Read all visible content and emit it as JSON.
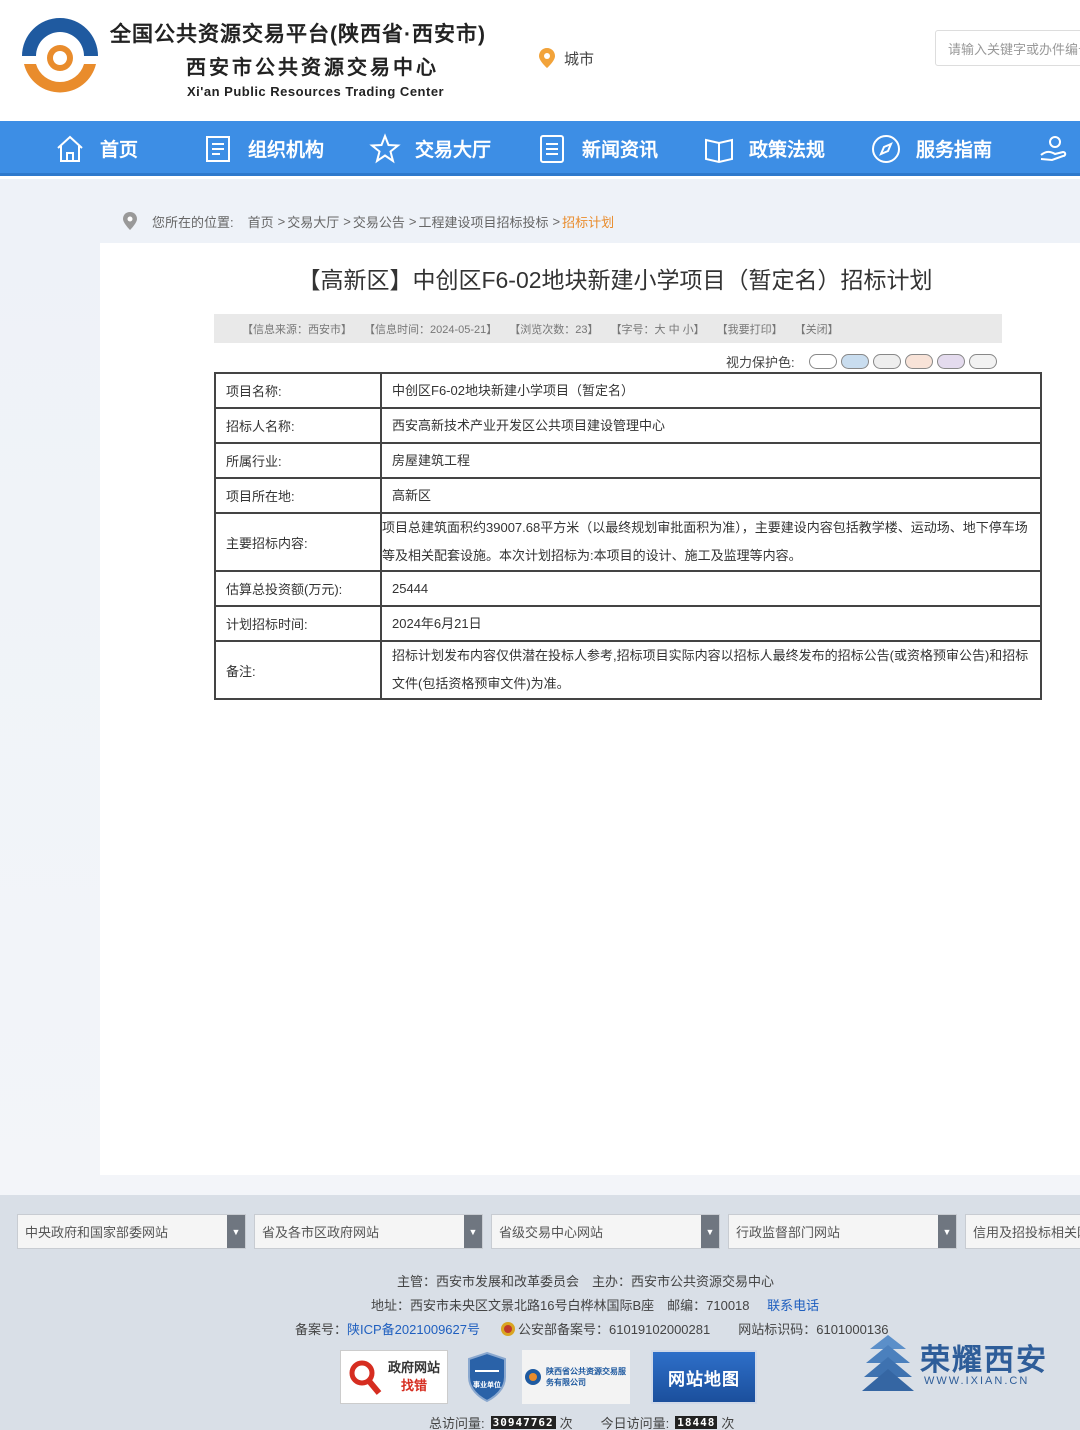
{
  "header": {
    "logo_line1": "全国公共资源交易平台(陕西省·西安市)",
    "logo_line2": "西安市公共资源交易中心",
    "logo_line3": "Xi'an Public Resources Trading Center",
    "city_label": "城市",
    "search_placeholder": "请输入关键字或办件编号"
  },
  "nav": {
    "items": [
      {
        "label": "首页",
        "icon": "home-icon"
      },
      {
        "label": "组织机构",
        "icon": "document-icon"
      },
      {
        "label": "交易大厅",
        "icon": "star-icon"
      },
      {
        "label": "新闻资讯",
        "icon": "news-icon"
      },
      {
        "label": "政策法规",
        "icon": "book-icon"
      },
      {
        "label": "服务指南",
        "icon": "compass-icon"
      }
    ]
  },
  "breadcrumb": {
    "prefix": "您所在的位置:",
    "items": [
      "首页",
      "交易大厅",
      "交易公告",
      "工程建设项目招标投标"
    ],
    "current": "招标计划"
  },
  "article": {
    "title": "【高新区】中创区F6-02地块新建小学项目（暂定名）招标计划",
    "info": {
      "source": "【信息来源：西安市】",
      "time": "【信息时间：2024-05-21】",
      "views": "【浏览次数：23】",
      "font_size": "【字号：大 中 小】",
      "print": "【我要打印】",
      "close": "【关闭】"
    },
    "vision_label": "视力保护色:",
    "vision_colors": [
      "#ffffff",
      "#c9ddef",
      "#eeeeee",
      "#f8e3d8",
      "#e4dbee",
      "#f2f2f2"
    ],
    "rows": [
      {
        "label": "项目名称:",
        "value": "中创区F6-02地块新建小学项目（暂定名）"
      },
      {
        "label": "招标人名称:",
        "value": "西安高新技术产业开发区公共项目建设管理中心"
      },
      {
        "label": "所属行业:",
        "value": "房屋建筑工程"
      },
      {
        "label": "项目所在地:",
        "value": "高新区"
      },
      {
        "label": "主要招标内容:",
        "value": "项目总建筑面积约39007.68平方米（以最终规划审批面积为准），主要建设内容包括教学楼、运动场、地下停车场等及相关配套设施。本次计划招标为:本项目的设计、施工及监理等内容。"
      },
      {
        "label": "估算总投资额(万元):",
        "value": "25444"
      },
      {
        "label": "计划招标时间:",
        "value": "2024年6月21日"
      },
      {
        "label": "备注:",
        "value": "招标计划发布内容仅供潜在投标人参考,招标项目实际内容以招标人最终发布的招标公告(或资格预审公告)和招标文件(包括资格预审文件)为准。"
      }
    ]
  },
  "footer": {
    "selects": [
      "中央政府和国家部委网站",
      "省及各市区政府网站",
      "省级交易中心网站",
      "行政监督部门网站",
      "信用及招投标相关网站"
    ],
    "line1": "主管：西安市发展和改革委员会　主办：西安市公共资源交易中心",
    "address": "地址：西安市未央区文景北路16号白桦林国际B座　邮编：710018",
    "contact": "联系电话",
    "icp_prefix": "备案号：",
    "icp": "陕ICP备2021009627号",
    "police": "公安部备案号：61019102000281",
    "site_code": "网站标识码：6101000136",
    "badge_gov_top": "政府网站",
    "badge_gov_bottom": "找错",
    "badge_shield": "事业单位",
    "badge_company": "陕西省公共资源交易服务有限公司",
    "badge_sitemap": "网站地图",
    "brand_name": "荣耀西安",
    "brand_url": "WWW.IXIAN.CN",
    "total_label": "总访问量:",
    "total_value": "30947762",
    "today_label": "今日访问量:",
    "today_value": "18448",
    "unit": "次"
  }
}
